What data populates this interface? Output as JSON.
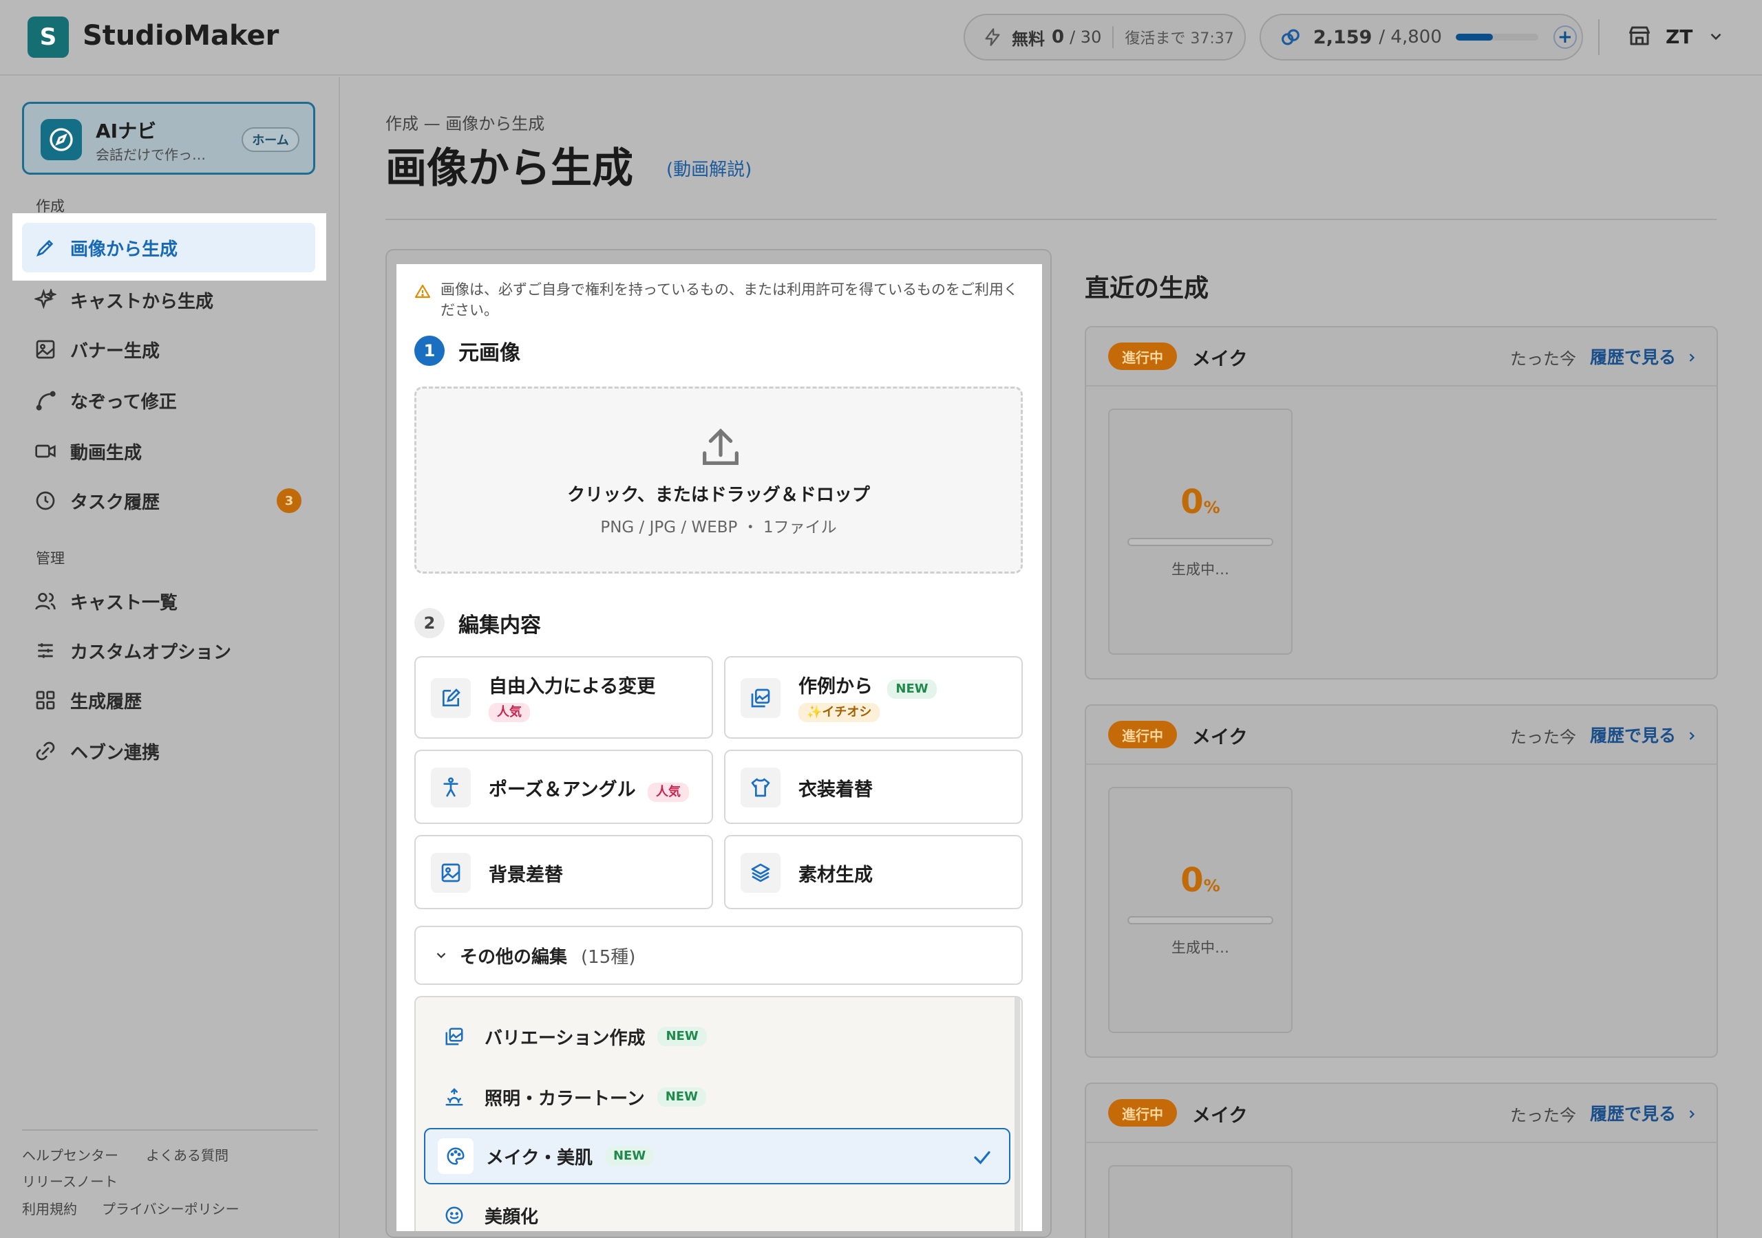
{
  "app": {
    "logo_letter": "S",
    "name": "StudioMaker"
  },
  "topbar": {
    "free_label": "無料",
    "free_used": "0",
    "free_total": "/ 30",
    "recover_text": "復活まで 37:37",
    "credits": "2,159",
    "credits_total": "/ 4,800",
    "credits_fraction": 0.45,
    "user_initials": "ZT"
  },
  "sidebar": {
    "ainavi_title": "AIナビ",
    "ainavi_sub": "会話だけで作っ…",
    "ainavi_badge": "ホーム",
    "section_create": "作成",
    "create_items": [
      {
        "label": "画像から生成",
        "icon": "brush-icon"
      },
      {
        "label": "キャストから生成",
        "icon": "sparkle-icon"
      },
      {
        "label": "バナー生成",
        "icon": "image-icon"
      },
      {
        "label": "なぞって修正",
        "icon": "curve-icon"
      },
      {
        "label": "動画生成",
        "icon": "video-icon"
      },
      {
        "label": "タスク履歴",
        "icon": "clock-icon",
        "badge": "3"
      }
    ],
    "section_manage": "管理",
    "manage_items": [
      {
        "label": "キャスト一覧",
        "icon": "users-icon"
      },
      {
        "label": "カスタムオプション",
        "icon": "sliders-icon"
      },
      {
        "label": "生成履歴",
        "icon": "grid-icon"
      },
      {
        "label": "ヘブン連携",
        "icon": "link-icon"
      }
    ],
    "footer": {
      "help": "ヘルプセンター",
      "faq": "よくある質問",
      "release": "リリースノート",
      "terms": "利用規約",
      "privacy": "プライバシーポリシー"
    }
  },
  "main": {
    "breadcrumb": "作成 — 画像から生成",
    "title": "画像から生成",
    "video_link": "(動画解説)",
    "warning": "画像は、必ずご自身で権利を持っているもの、または利用許可を得ているものをご利用ください。",
    "step1_num": "1",
    "step1_title": "元画像",
    "upload_title": "クリック、またはドラッグ＆ドロップ",
    "upload_sub": "PNG / JPG / WEBP ・ 1ファイル",
    "step2_num": "2",
    "step2_title": "編集内容",
    "options": [
      {
        "label": "自由入力による変更",
        "tag": "人気",
        "icon": "edit-icon"
      },
      {
        "label": "作例から",
        "tag": "NEW",
        "tag2": "✨イチオシ",
        "icon": "gallery-icon"
      },
      {
        "label": "ポーズ＆アングル",
        "tag": "人気",
        "icon": "person-icon"
      },
      {
        "label": "衣装着替",
        "icon": "shirt-icon"
      },
      {
        "label": "背景差替",
        "icon": "picture-icon"
      },
      {
        "label": "素材生成",
        "icon": "layers-icon"
      }
    ],
    "more_label": "その他の編集",
    "more_count": "(15種)",
    "more_items": [
      {
        "label": "バリエーション作成",
        "tag": "NEW",
        "icon": "gallery-icon"
      },
      {
        "label": "照明・カラートーン",
        "tag": "NEW",
        "icon": "sunrise-icon"
      },
      {
        "label": "メイク・美肌",
        "tag": "NEW",
        "icon": "palette-icon",
        "selected": true
      },
      {
        "label": "美顔化",
        "icon": "smile-icon"
      }
    ]
  },
  "recent": {
    "title": "直近の生成",
    "cards": [
      {
        "status": "進行中",
        "name": "メイク",
        "time": "たった今",
        "link": "履歴で見る",
        "percent": "0",
        "unit": "%",
        "progress": 0,
        "state": "生成中…"
      },
      {
        "status": "進行中",
        "name": "メイク",
        "time": "たった今",
        "link": "履歴で見る",
        "percent": "0",
        "unit": "%",
        "progress": 0,
        "state": "生成中…"
      },
      {
        "status": "進行中",
        "name": "メイク",
        "time": "たった今",
        "link": "履歴で見る"
      }
    ]
  },
  "colors": {
    "accent": "#1b6fc1",
    "brand": "#146e72",
    "status_orange": "#c46a08",
    "hot_pink": "#c7254e",
    "new_green": "#1f8a4c"
  }
}
